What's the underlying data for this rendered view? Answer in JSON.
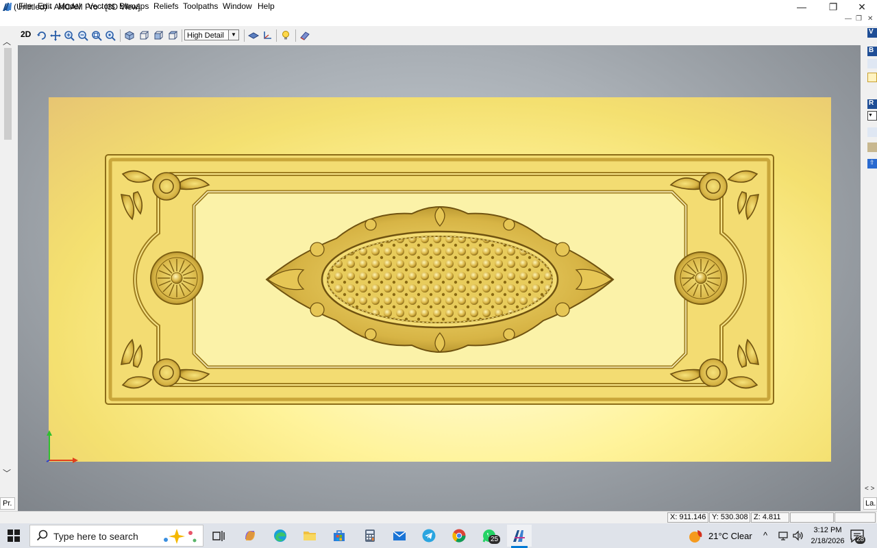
{
  "window": {
    "title": "(Untitled) - ArtCAM Pro - [3D View]",
    "minimize": "—",
    "maximize": "❐",
    "close": "✕"
  },
  "menu": {
    "items": [
      "File",
      "Edit",
      "Model",
      "Vectors",
      "Bitmaps",
      "Reliefs",
      "Toolpaths",
      "Window",
      "Help"
    ],
    "mdi_minimize": "—",
    "mdi_restore": "❐",
    "mdi_close": "✕"
  },
  "toolbar": {
    "mode_label": "2D",
    "detail_value": "High Detail"
  },
  "left_panel": {
    "tab_label": "Pr."
  },
  "right_panel": {
    "top_label": "V",
    "mid_label": "B",
    "lower_label": "R",
    "expand": "< >",
    "tab_label": "La."
  },
  "status": {
    "x": "X: 911.146",
    "y": "Y: 530.308",
    "z": "Z: 4.811"
  },
  "taskbar": {
    "search_placeholder": "Type here to search",
    "whatsapp_badge": "25",
    "weather": "21°C  Clear",
    "time": "3:12 PM",
    "date": "2/18/2026",
    "notifications": "28",
    "tray_arrow": "^"
  },
  "colors": {
    "accent": "#0078d4",
    "relief_gold": "#d9b94a",
    "plate_yellow": "#fff39a"
  }
}
